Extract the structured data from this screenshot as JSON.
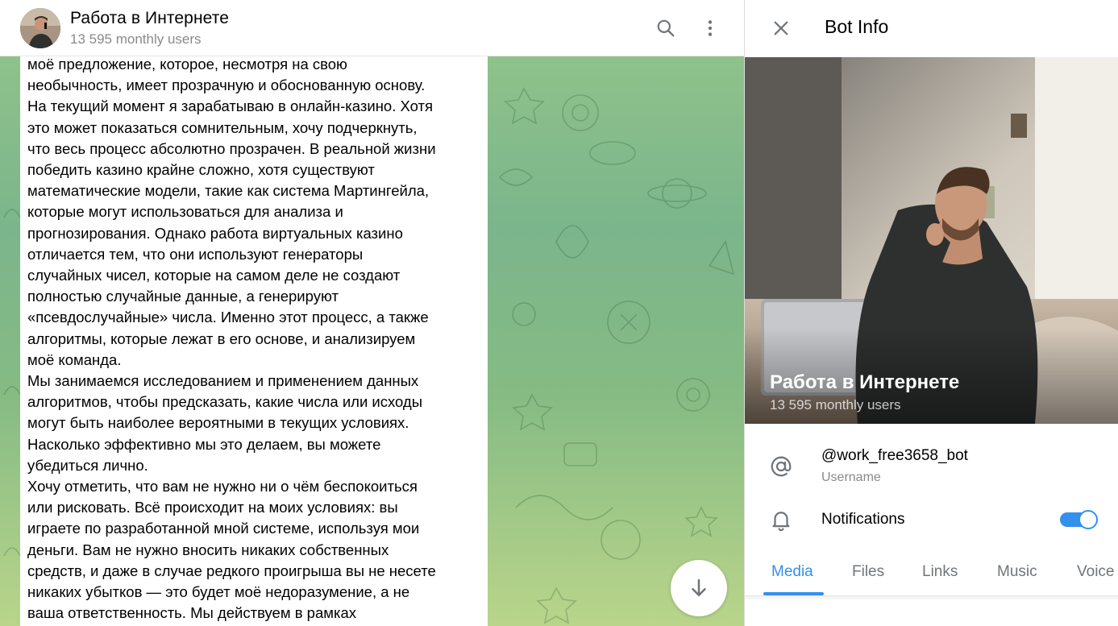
{
  "chat": {
    "title": "Работа в Интернете",
    "subtitle": "13 595 monthly users",
    "message_text": "моё предложение, которое, несмотря на свою\nнеобычность, имеет прозрачную и обоснованную основу.\nНа текущий момент я зарабатываю в онлайн-казино. Хотя\nэто может показаться сомнительным, хочу подчеркнуть,\nчто весь процесс абсолютно прозрачен. В реальной жизни\nпобедить казино крайне сложно, хотя существуют\nматематические модели, такие как система Мартингейла,\nкоторые могут использоваться для анализа и\nпрогнозирования. Однако работа виртуальных казино\nотличается тем, что они используют генераторы\nслучайных чисел, которые на самом деле не создают\nполностью случайные данные, а генерируют\n«псевдослучайные» числа. Именно этот процесс, а также\nалгоритмы, которые лежат в его основе, и анализируем\nмоё команда.\nМы занимаемся исследованием и применением данных\nалгоритмов, чтобы предсказать, какие числа или исходы\nмогут быть наиболее вероятными в текущих условиях.\nНасколько эффективно мы это делаем, вы можете\nубедиться лично.\nХочу отметить, что вам не нужно ни о чём беспокоиться\nили рисковать. Всё происходит на моих условиях: вы\nиграете по разработанной мной системе, используя мои\nденьги. Вам не нужно вносить никаких собственных\nсредств, и даже в случае редкого проигрыша вы не несете\nникаких убытков — это будет моё недоразумение, а не\nваша ответственность. Мы действуем в рамках",
    "icons": {
      "search": "search-icon",
      "more": "more-vertical-icon",
      "scroll": "arrow-down-icon"
    },
    "background_colors": [
      "#8fc28b",
      "#7bb58b",
      "#b9d58a"
    ]
  },
  "panel": {
    "title": "Bot Info",
    "close_icon": "close-icon",
    "cover": {
      "name": "Работа в Интернете",
      "subtitle": "13 595 monthly users"
    },
    "username": {
      "value": "@work_free3658_bot",
      "label": "Username",
      "icon": "at-sign-icon"
    },
    "notifications": {
      "label": "Notifications",
      "icon": "bell-icon",
      "enabled": true
    },
    "tabs": [
      {
        "label": "Media",
        "active": true
      },
      {
        "label": "Files",
        "active": false
      },
      {
        "label": "Links",
        "active": false
      },
      {
        "label": "Music",
        "active": false
      },
      {
        "label": "Voice",
        "active": false
      }
    ],
    "accent_color": "#3390ec"
  }
}
